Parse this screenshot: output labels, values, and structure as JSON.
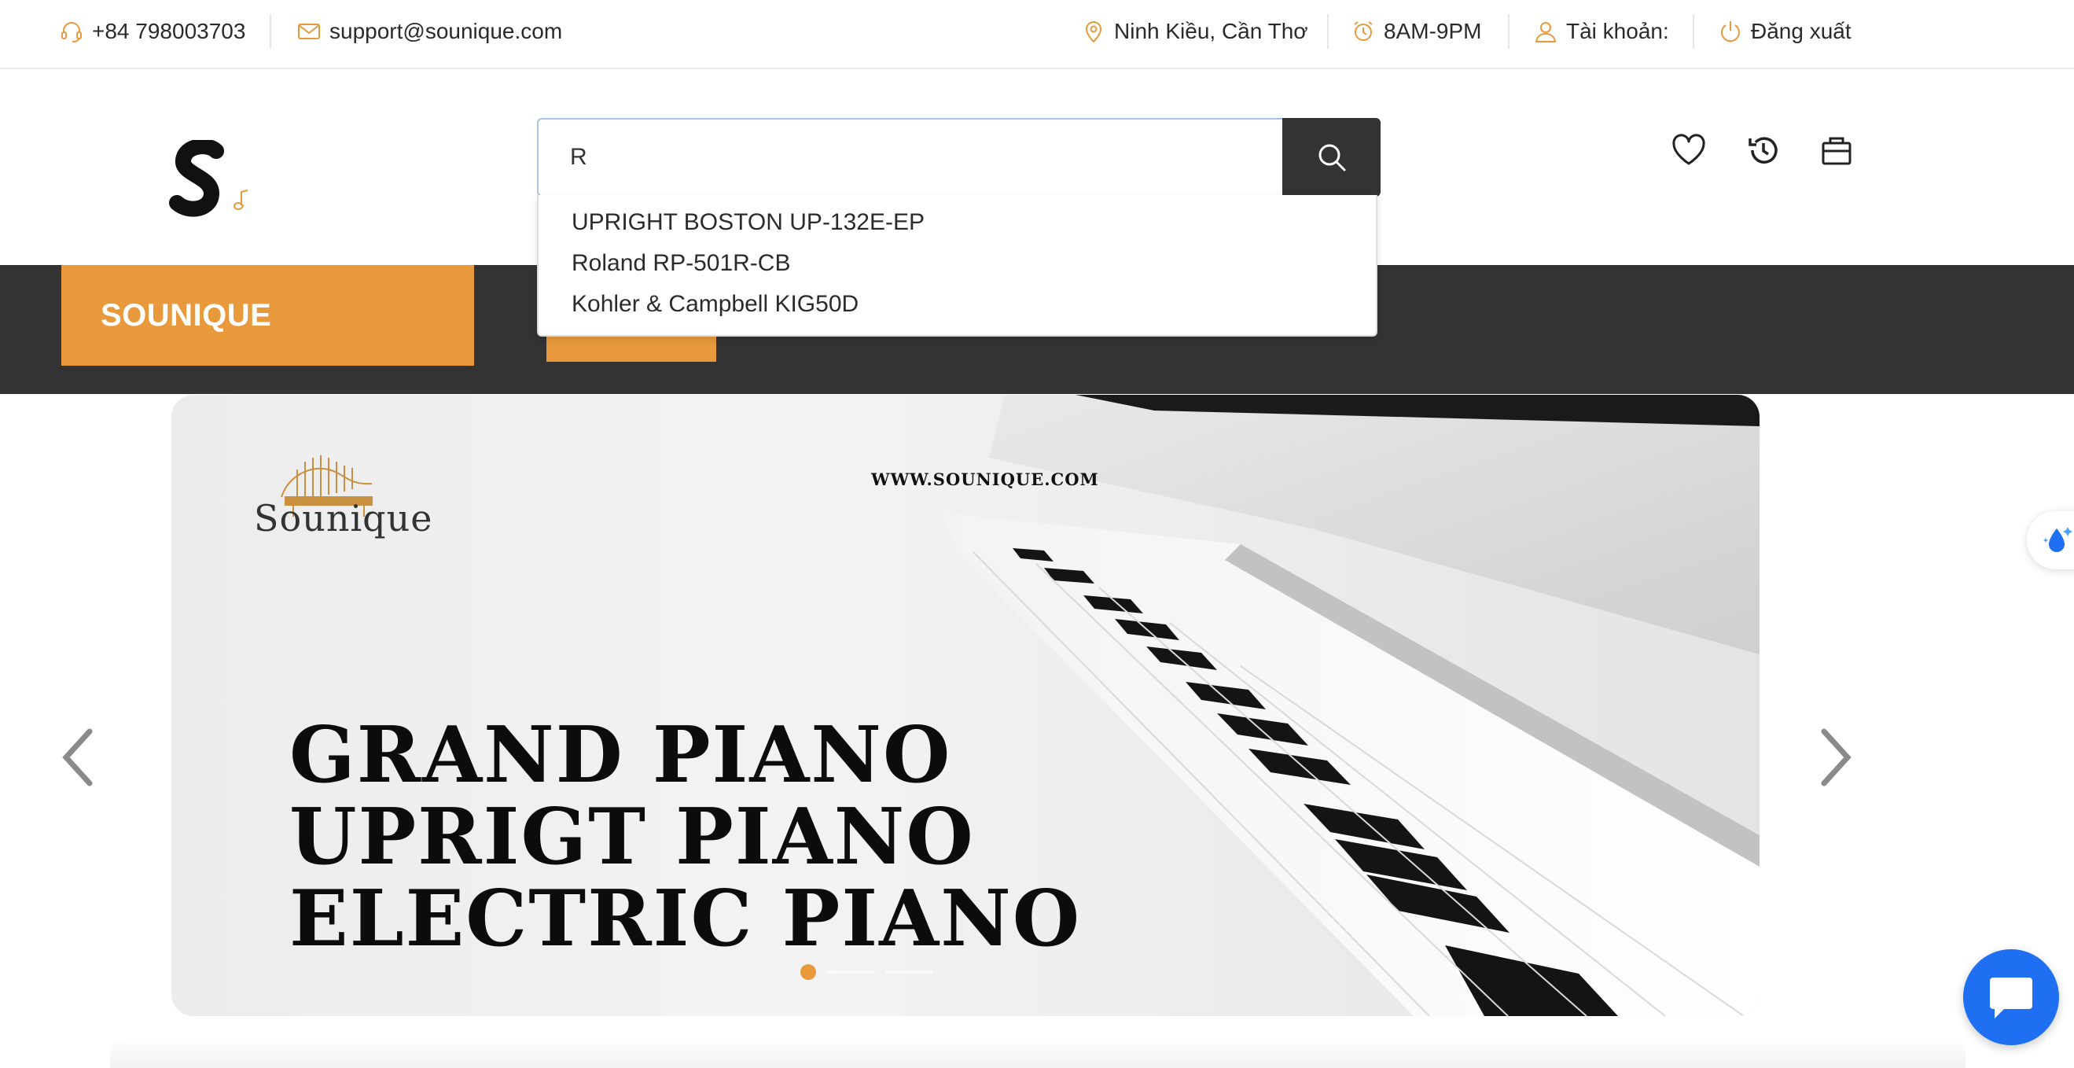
{
  "topbar": {
    "phone": "+84 798003703",
    "email": "support@sounique.com",
    "location": "Ninh Kiều, Cần Thơ",
    "hours": "8AM-9PM",
    "account_label": "Tài khoản:",
    "logout_label": "Đăng xuất",
    "accent_color": "#e8993c"
  },
  "search": {
    "value": "R",
    "suggestions": [
      "UPRIGHT BOSTON UP-132E-EP",
      "Roland RP-501R-CB",
      "Kohler & Campbell KIG50D"
    ]
  },
  "header_icons": [
    "heart-icon",
    "history-icon",
    "cart-icon"
  ],
  "nav": {
    "brand": "SOUNIQUE"
  },
  "banner": {
    "url_text": "WWW.SOUNIQUE.COM",
    "logo_text": "Sounique",
    "headlines": [
      "GRAND PIANO",
      "UPRIGT PIANO",
      "ELECTRIC PIANO"
    ],
    "slide_count": 3,
    "active_slide": 1
  },
  "colors": {
    "accent": "#e8993c",
    "dark": "#333333",
    "chat": "#1f6ff2"
  }
}
